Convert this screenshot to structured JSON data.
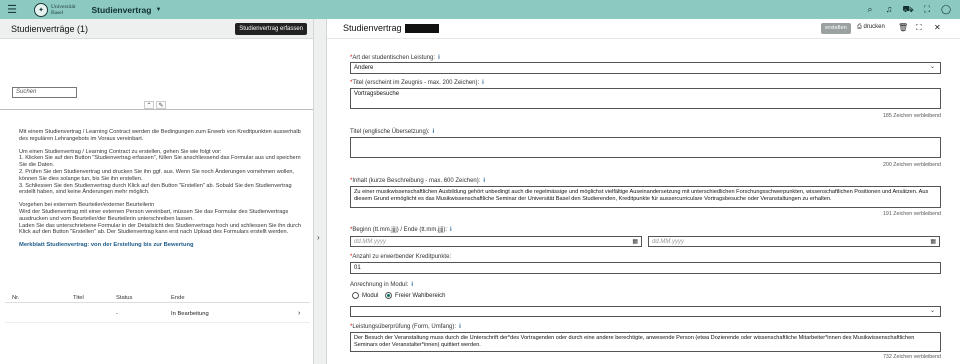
{
  "topbar": {
    "university": [
      "Universität",
      "Basel"
    ],
    "app_title": "Studienvertrag"
  },
  "left": {
    "title": "Studienverträge (1)",
    "create_button": "Studienvertrag erfassen",
    "search_placeholder": "Suchen",
    "info_paragraphs": [
      "Mit einem Studienvertrag / Learning Contract werden die Bedingungen zum Erwerb von Kreditpunkten ausserhalb des regulären Lehrangebots im Voraus vereinbart.",
      "Um einen Studienvertrag / Learning Contract zu erstellen, gehen Sie wie folgt vor:\n1. Klicken Sie auf den Button \"Studienvertrag erfassen\", füllen Sie anschliessend das Formular aus und speichern Sie die Daten.\n2. Prüfen Sie den Studienvertrag und drucken Sie ihn ggf. aus. Wenn Sie noch Änderungen vornehmen wollen, können Sie dies solange tun, bis Sie ihn erstellen.\n3. Schliessen Sie den Studienvertrag durch Klick auf den Button \"Erstellen\" ab. Sobald Sie den Studienvertrag erstellt haben, sind keine Änderungen mehr möglich.",
      "Vorgehen bei externem Beurteiler/externer Beurteilerin\nWird der Studienvertrag mit einer externen Person vereinbart, müssen Sie das Formular des Studienvertrags ausdrucken und vom Beurteiler/der Beurteilerin unterschreiben lassen.\nLaden Sie das unterschriebene Formular in der Detailsicht des Studienvertrags hoch und schliessen Sie ihn durch Klick auf den Button \"Erstellen\" ab. Der Studienvertrag kann erst nach Upload des Formulars erstellt werden."
    ],
    "link": "Merkblatt Studienvertrag: von der Erstellung bis zur Bewertung",
    "table": {
      "headers": [
        "Nr.",
        "Titel",
        "Status",
        "Ende"
      ],
      "row": {
        "titel": "",
        "status": "-",
        "ende": "In Bearbeitung"
      }
    }
  },
  "right": {
    "title": "Studienvertrag",
    "erstellen": "erstellen",
    "drucken": "drucken",
    "art_label": "Art der studentischen Leistung:",
    "art_value": "Andere",
    "titel_label": "Titel (erscheint im Zeugnis - max. 200 Zeichen):",
    "titel_value": "Vortragsbesuche",
    "titel_counter": "185 Zeichen verbleibend",
    "titel_en_label": "Titel (englische Übersetzung):",
    "titel_en_counter": "200 Zeichen verbleibend",
    "inhalt_label": "Inhalt (kurze Beschreibung - max. 600 Zeichen):",
    "inhalt_value": "Zu einer musikwissenschaftlichen Ausbildung gehört unbedingt auch die regelmässige und möglichst vielfältige Auseinandersetzung mit unterschiedlichen Forschungsschwerpunkten, wissenschaftlichen Positionen und Ansätzen. Aus diesem Grund ermöglicht es das Musikwissenschaftliche Seminar der Universität Basel den Studierenden, Kreditpunkte für ausser­curriculare Vortragsbesuche oder Veranstaltungen zu erhalten.",
    "inhalt_counter": "191 Zeichen verbleibend",
    "datum_label": "Beginn (tt.mm.jjjj) / Ende (tt.mm.jjjj):",
    "date_placeholder": "dd.MM.yyyy",
    "kp_label": "Anzahl zu erwerbender Kreditpunkte:",
    "kp_value": "01",
    "modul_label": "Anrechnung in Modul:",
    "radio_modul": "Modul",
    "radio_frei": "Freier Wahlbereich",
    "leistung_label": "Leistungsüberprüfung (Form, Umfang):",
    "leistung_value": "Der Besuch der Veranstaltung muss durch die Unterschrift der*des Vortragenden oder durch eine andere berechtigte, anwesende Person (etwa Dozierende oder wissenschaftliche Mitarbeiter*innen des Musikwissenschaftlichen Seminars oder Veranstalter*innen) quittiert werden.",
    "leistung_counter": "732 Zeichen verbleibend"
  }
}
